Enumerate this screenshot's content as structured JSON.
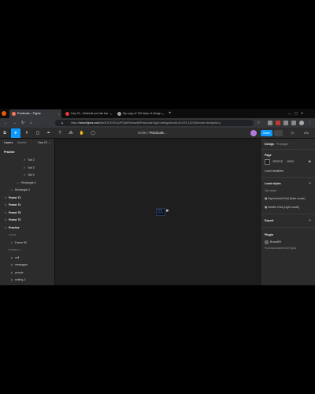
{
  "browser": {
    "tabs": [
      {
        "label": "Practicals – Figma",
        "active": true,
        "color": "#ff7262"
      },
      {
        "label": "Day 15 – Material you tab bar",
        "active": false,
        "color": "#e53935"
      },
      {
        "label": "My copy of 100 days of design",
        "active": false,
        "color": "#9e9e9e"
      }
    ],
    "new_tab": "+",
    "url_prefix": "https://",
    "url_domain": "www.figma.com",
    "url_rest": "/file/JOCE1EUuZFQdkRxmwz8t/Practicals?type=design&node-id=475-13234&mode=design&t=y"
  },
  "figma": {
    "breadcrumb_drafts": "Drafts",
    "breadcrumb_sep": "/",
    "breadcrumb_file": "Practicals",
    "share_label": "Share",
    "zoom": "2%"
  },
  "left_panel": {
    "tab_layers": "Layers",
    "tab_assets": "Assets",
    "page_selector": "Day 15",
    "page_name": "Practice",
    "layers": [
      {
        "label": "Tab 2",
        "indent": 3,
        "icon": "frame-icon",
        "kind": "normal"
      },
      {
        "label": "Tab 3",
        "indent": 3,
        "icon": "frame-icon",
        "kind": "normal"
      },
      {
        "label": "Tab 4",
        "indent": 3,
        "icon": "frame-icon",
        "kind": "normal"
      },
      {
        "label": "Rectangle 3",
        "indent": 2,
        "icon": "rect-icon",
        "kind": "normal"
      },
      {
        "label": "Rectangle 4",
        "indent": 1,
        "icon": "rect-icon",
        "kind": "normal"
      },
      {
        "label": "Frame 71",
        "indent": 0,
        "icon": "frame-icon",
        "kind": "bold"
      },
      {
        "label": "Frame 74",
        "indent": 0,
        "icon": "frame-icon",
        "kind": "bold"
      },
      {
        "label": "Frame 75",
        "indent": 0,
        "icon": "frame-icon",
        "kind": "bold"
      },
      {
        "label": "Frame 73",
        "indent": 0,
        "icon": "frame-icon",
        "kind": "bold"
      },
      {
        "label": "Practice",
        "indent": 0,
        "icon": "frame-icon",
        "kind": "bold"
      },
      {
        "label": "ICONS",
        "indent": 1,
        "icon": "",
        "kind": "sec"
      },
      {
        "label": "Frame 80",
        "indent": 1,
        "icon": "frame-icon",
        "kind": "normal"
      },
      {
        "label": "NORMALS",
        "indent": 1,
        "icon": "",
        "kind": "sec"
      },
      {
        "label": "call",
        "indent": 1,
        "icon": "component-icon",
        "kind": "normal"
      },
      {
        "label": "messages",
        "indent": 1,
        "icon": "component-icon",
        "kind": "normal"
      },
      {
        "label": "people",
        "indent": 1,
        "icon": "component-icon",
        "kind": "normal"
      },
      {
        "label": "setting-2",
        "indent": 1,
        "icon": "component-icon",
        "kind": "normal"
      },
      {
        "label": "Tab bar",
        "indent": 1,
        "icon": "frame-icon",
        "kind": "normal"
      }
    ]
  },
  "right_panel": {
    "tab_design": "Design",
    "tab_prototype": "Prototype",
    "page_heading": "Page",
    "bg_hex": "1E1E1E",
    "bg_opacity": "100%",
    "bg_color": "#1e1e1e",
    "local_variables": "Local variables",
    "local_styles": "Local styles",
    "grid_styles": "Grid styles",
    "grids": [
      "Big Android Grid (Dark mode)",
      "Mobile Grid (Light mode)"
    ],
    "export": "Export",
    "plugin_heading": "Plugin",
    "plugin_name": "BrandKit",
    "plugin_desc": "Pull brand assets into Figma",
    "help": "?"
  },
  "colors": {
    "accent": "#0d99ff",
    "canvas": "#1e1e1e",
    "panel": "#2c2c2c"
  }
}
